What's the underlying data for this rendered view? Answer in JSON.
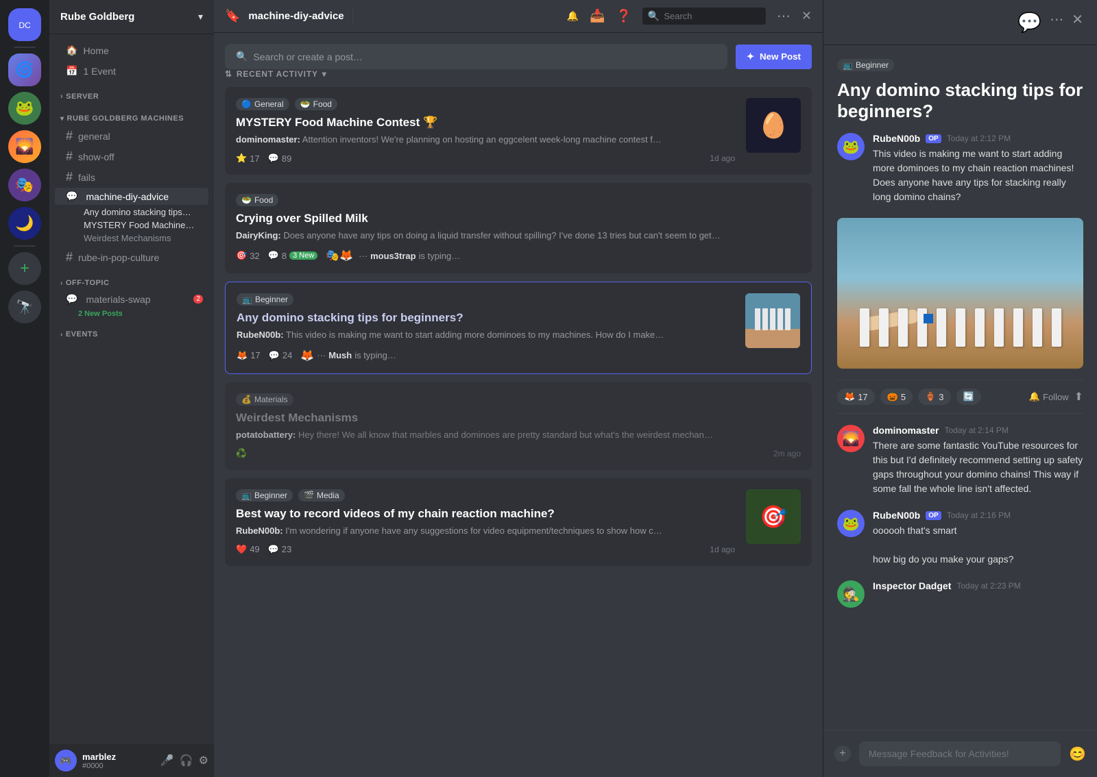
{
  "server_bar": {
    "icons": [
      {
        "id": "discord-home",
        "emoji": "🎮",
        "type": "home"
      },
      {
        "id": "server-1",
        "emoji": "🌀",
        "type": "server",
        "active": false
      },
      {
        "id": "server-2",
        "emoji": "🐸",
        "type": "server"
      },
      {
        "id": "server-3",
        "emoji": "🌄",
        "type": "server"
      },
      {
        "id": "server-4",
        "emoji": "🎭",
        "type": "server"
      },
      {
        "id": "server-5",
        "emoji": "🌙",
        "type": "server"
      },
      {
        "id": "add-server",
        "emoji": "+",
        "type": "add"
      },
      {
        "id": "discover",
        "emoji": "🔭",
        "type": "discover"
      }
    ]
  },
  "sidebar": {
    "server_name": "Rube Goldberg",
    "home_label": "Home",
    "events_label": "1 Event",
    "sections": [
      {
        "name": "SERVER",
        "channels": []
      },
      {
        "name": "RUBE GOLDBERG MACHINES",
        "channels": [
          {
            "name": "general",
            "type": "hash",
            "active": false
          },
          {
            "name": "show-off",
            "type": "hash",
            "active": false
          },
          {
            "name": "fails",
            "type": "hash",
            "active": false
          },
          {
            "name": "machine-diy-advice",
            "type": "forum",
            "active": true
          }
        ],
        "threads": [
          {
            "name": "Any domino stacking tips…",
            "active": true
          },
          {
            "name": "MYSTERY Food Machine…",
            "active": true
          },
          {
            "name": "Weirdest Mechanisms",
            "active": false
          }
        ]
      },
      {
        "name": "",
        "channels": [
          {
            "name": "rube-in-pop-culture",
            "type": "hash"
          }
        ]
      },
      {
        "name": "",
        "channels": [
          {
            "name": "materials-swap",
            "type": "forum",
            "badge": "2 New Posts"
          }
        ]
      }
    ],
    "section_labels": {
      "off_topic": "OFF-TOPIC",
      "events": "EVENTS"
    }
  },
  "header": {
    "channel_name": "machine-diy-advice",
    "search_placeholder": "Search"
  },
  "forum": {
    "search_placeholder": "Search or create a post…",
    "new_post_label": "New Post",
    "activity_label": "RECENT ACTIVITY",
    "posts": [
      {
        "id": "post-1",
        "tags": [
          "General",
          "Food"
        ],
        "tag_emojis": [
          "🔵",
          "🥗"
        ],
        "title": "MYSTERY Food Machine Contest 🏆",
        "author": "dominomaster",
        "preview": "Attention inventors! We're planning on hosting an eggcelent week-long machine contest f…",
        "reactions": "17",
        "reaction_emoji": "⭐",
        "comments": "89",
        "time": "1d ago",
        "has_thumbnail": true,
        "thumb_type": "eggs",
        "thumb_emoji": "🥚"
      },
      {
        "id": "post-2",
        "tags": [
          "Food"
        ],
        "tag_emojis": [
          "🥗"
        ],
        "title": "Crying over Spilled Milk",
        "author": "DairyKing",
        "preview": "Does anyone have any tips on doing a liquid transfer without spilling? I've done 13 tries but can't seem to get…",
        "reactions": "32",
        "reaction_emoji": "🎯",
        "comments": "8",
        "new_comments": "3 New",
        "typing_user": "mous3trap",
        "typing_text": "is typing…",
        "has_thumbnail": false
      },
      {
        "id": "post-3",
        "tags": [
          "Beginner"
        ],
        "tag_emojis": [
          "📺"
        ],
        "title": "Any domino stacking tips for beginners?",
        "author": "RubeN00b",
        "preview": "This video is making me want to start adding more dominoes to my machines. How do I make…",
        "reactions": "17",
        "reaction_emoji": "🦊",
        "comments": "24",
        "typing_user": "Mush",
        "typing_text": "is typing…",
        "has_thumbnail": true,
        "thumb_type": "domino",
        "thumb_emoji": "🎲",
        "selected": true
      },
      {
        "id": "post-4",
        "tags": [
          "Materials"
        ],
        "tag_emojis": [
          "💰"
        ],
        "title": "Weirdest Mechanisms",
        "author": "potatobattery",
        "preview": "Hey there! We all know that marbles and dominoes are pretty standard but what's the weirdest mechan…",
        "reactions": "",
        "reaction_emoji": "♻️",
        "comments": "",
        "time": "2m ago",
        "has_thumbnail": false,
        "dimmed": true
      },
      {
        "id": "post-5",
        "tags": [
          "Beginner",
          "Media"
        ],
        "tag_emojis": [
          "📺",
          "🎬"
        ],
        "title": "Best way to record videos of my chain reaction machine?",
        "author": "RubeN00b",
        "preview": "I'm wondering if anyone have any suggestions for video equipment/techniques to show how c…",
        "reactions": "49",
        "reaction_emoji": "❤️",
        "comments": "23",
        "time": "1d ago",
        "has_thumbnail": true,
        "thumb_type": "green",
        "thumb_emoji": "🎯"
      }
    ]
  },
  "right_panel": {
    "tag": "Beginner",
    "tag_emoji": "📺",
    "title": "Any domino stacking tips for beginners?",
    "reactions": [
      {
        "emoji": "🦊",
        "count": "17"
      },
      {
        "emoji": "🎃",
        "count": "5"
      },
      {
        "emoji": "🏺",
        "count": "3"
      },
      {
        "emoji": "🔄",
        "count": ""
      }
    ],
    "follow_label": "Follow",
    "messages": [
      {
        "author": "RubeN00b",
        "op": true,
        "time": "Today at 2:12 PM",
        "text": "This video is making me want to start adding more dominoes to my chain reaction machines! Does anyone have any tips for stacking really long domino chains?",
        "avatar_color": "#5865f2",
        "avatar_emoji": "🐸"
      },
      {
        "author": "dominomaster",
        "op": false,
        "time": "Today at 2:14 PM",
        "text": "There are some fantastic YouTube resources for this but I'd definitely recommend setting up safety gaps throughout your domino chains! This way if some fall the whole line isn't affected.",
        "avatar_color": "#ed4245",
        "avatar_emoji": "🌄"
      },
      {
        "author": "RubeN00b",
        "op": true,
        "time": "Today at 2:16 PM",
        "text": "oooooh that's smart\n\nhow big do you make your gaps?",
        "avatar_color": "#5865f2",
        "avatar_emoji": "🐸"
      },
      {
        "author": "Inspector Dadget",
        "op": false,
        "time": "Today at 2:23 PM",
        "text": "",
        "avatar_color": "#3ba55c",
        "avatar_emoji": "🕵️"
      }
    ],
    "input_placeholder": "Message Feedback for Activities!"
  },
  "user": {
    "name": "marblez",
    "tag": "#0000",
    "avatar_emoji": "🎮",
    "avatar_color": "#5865f2"
  }
}
